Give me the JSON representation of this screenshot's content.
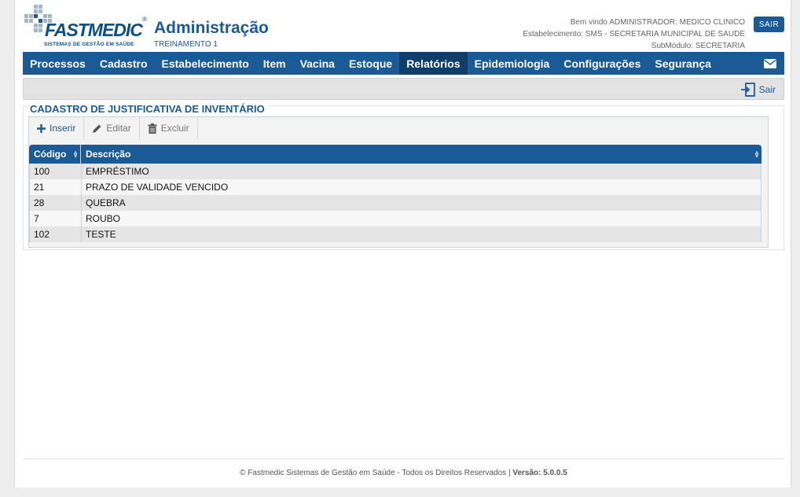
{
  "brand": {
    "logo_text": "FASTMEDIC",
    "logo_sub": "SISTEMAS DE GESTÃO EM SAÚDE",
    "logo_reg": "®",
    "primary_color": "#1a5a96"
  },
  "header": {
    "title": "Administração",
    "subtitle": "TREINAMENTO 1",
    "welcome": "Bem vindo ADMINISTRADOR: MEDICO CLINICO",
    "establishment": "Estabelecimento: SMS - SECRETARIA MUNICIPAL DE SAUDE",
    "submodule": "SubMódulo: SECRETARIA",
    "logout_label": "SAIR"
  },
  "nav": {
    "items": [
      {
        "label": "Processos"
      },
      {
        "label": "Cadastro"
      },
      {
        "label": "Estabelecimento"
      },
      {
        "label": "Item"
      },
      {
        "label": "Vacina"
      },
      {
        "label": "Estoque"
      },
      {
        "label": "Relatórios"
      },
      {
        "label": "Epidemiologia"
      },
      {
        "label": "Configurações"
      },
      {
        "label": "Segurança"
      }
    ],
    "active": "Relatórios",
    "mail_icon": "envelope-icon"
  },
  "toolbar": {
    "exit_label": "Sair",
    "exit_icon": "exit-door-icon"
  },
  "panel": {
    "title": "CADASTRO DE JUSTIFICATIVA DE INVENTÁRIO",
    "actions": [
      {
        "label": "Inserir",
        "icon": "plus-icon"
      },
      {
        "label": "Editar",
        "icon": "pencil-icon"
      },
      {
        "label": "Excluir",
        "icon": "trash-icon"
      }
    ],
    "columns": [
      "Código",
      "Descrição"
    ],
    "rows": [
      {
        "codigo": "100",
        "descricao": "EMPRÉSTIMO"
      },
      {
        "codigo": "21",
        "descricao": "PRAZO DE VALIDADE VENCIDO"
      },
      {
        "codigo": "28",
        "descricao": "QUEBRA"
      },
      {
        "codigo": "7",
        "descricao": "ROUBO"
      },
      {
        "codigo": "102",
        "descricao": "TESTE"
      }
    ]
  },
  "footer": {
    "text": "© Fastmedic Sistemas de Gestão em Saúde - Todos os Direitos Reservados |",
    "version": "Versão: 5.0.0.5"
  }
}
